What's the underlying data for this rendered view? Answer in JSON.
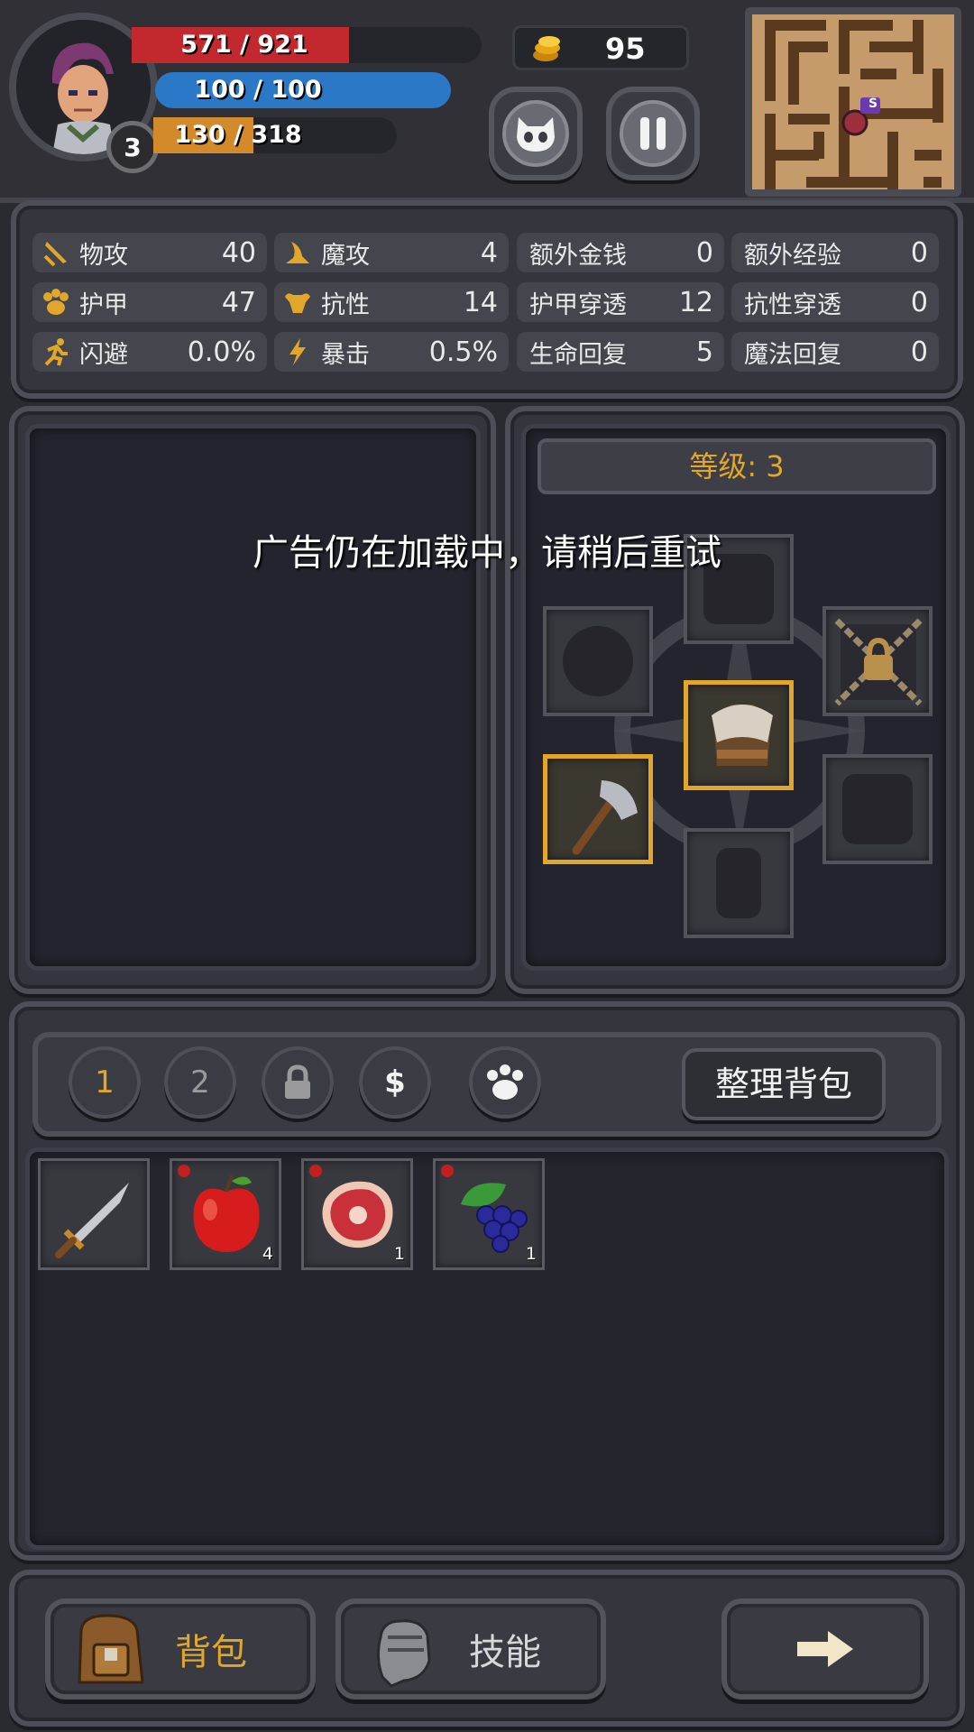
{
  "hud": {
    "hp_text": "571 / 921",
    "hp_fraction": 0.62,
    "mp_text": "100 / 100",
    "mp_fraction": 1.0,
    "xp_text": "130 / 318",
    "xp_fraction": 0.41,
    "level": "3",
    "gold": "95",
    "minimap_marker": "S",
    "colors": {
      "hp": "#c2292f",
      "mp": "#2b78c6",
      "xp": "#d38a2a",
      "accent": "#e0a72a"
    }
  },
  "stats": [
    {
      "icon": "sword-icon",
      "label": "物攻",
      "value": "40"
    },
    {
      "icon": "wizard-hat-icon",
      "label": "魔攻",
      "value": "4"
    },
    {
      "icon": "",
      "label": "额外金钱",
      "value": "0"
    },
    {
      "icon": "",
      "label": "额外经验",
      "value": "0"
    },
    {
      "icon": "paw-armor-icon",
      "label": "护甲",
      "value": "47"
    },
    {
      "icon": "muscle-icon",
      "label": "抗性",
      "value": "14"
    },
    {
      "icon": "",
      "label": "护甲穿透",
      "value": "12"
    },
    {
      "icon": "",
      "label": "抗性穿透",
      "value": "0"
    },
    {
      "icon": "running-man-icon",
      "label": "闪避",
      "value": "0.0%"
    },
    {
      "icon": "lightning-icon",
      "label": "暴击",
      "value": "0.5%"
    },
    {
      "icon": "",
      "label": "生命回复",
      "value": "5"
    },
    {
      "icon": "",
      "label": "魔法回复",
      "value": "0"
    }
  ],
  "equipment": {
    "level_label": "等级: 3",
    "toast": "广告仍在加载中，请稍后重试"
  },
  "bag": {
    "tabs": [
      "1",
      "2",
      "lock-icon",
      "$",
      "paw-icon"
    ],
    "sort_label": "整理背包",
    "items": [
      {
        "name": "dagger-icon",
        "count": "",
        "new": false
      },
      {
        "name": "apple-icon",
        "count": "4",
        "new": true
      },
      {
        "name": "meat-icon",
        "count": "1",
        "new": true
      },
      {
        "name": "grapes-icon",
        "count": "1",
        "new": true
      }
    ]
  },
  "nav": {
    "bag_label": "背包",
    "skill_label": "技能",
    "next_icon": "arrow-right-icon"
  }
}
